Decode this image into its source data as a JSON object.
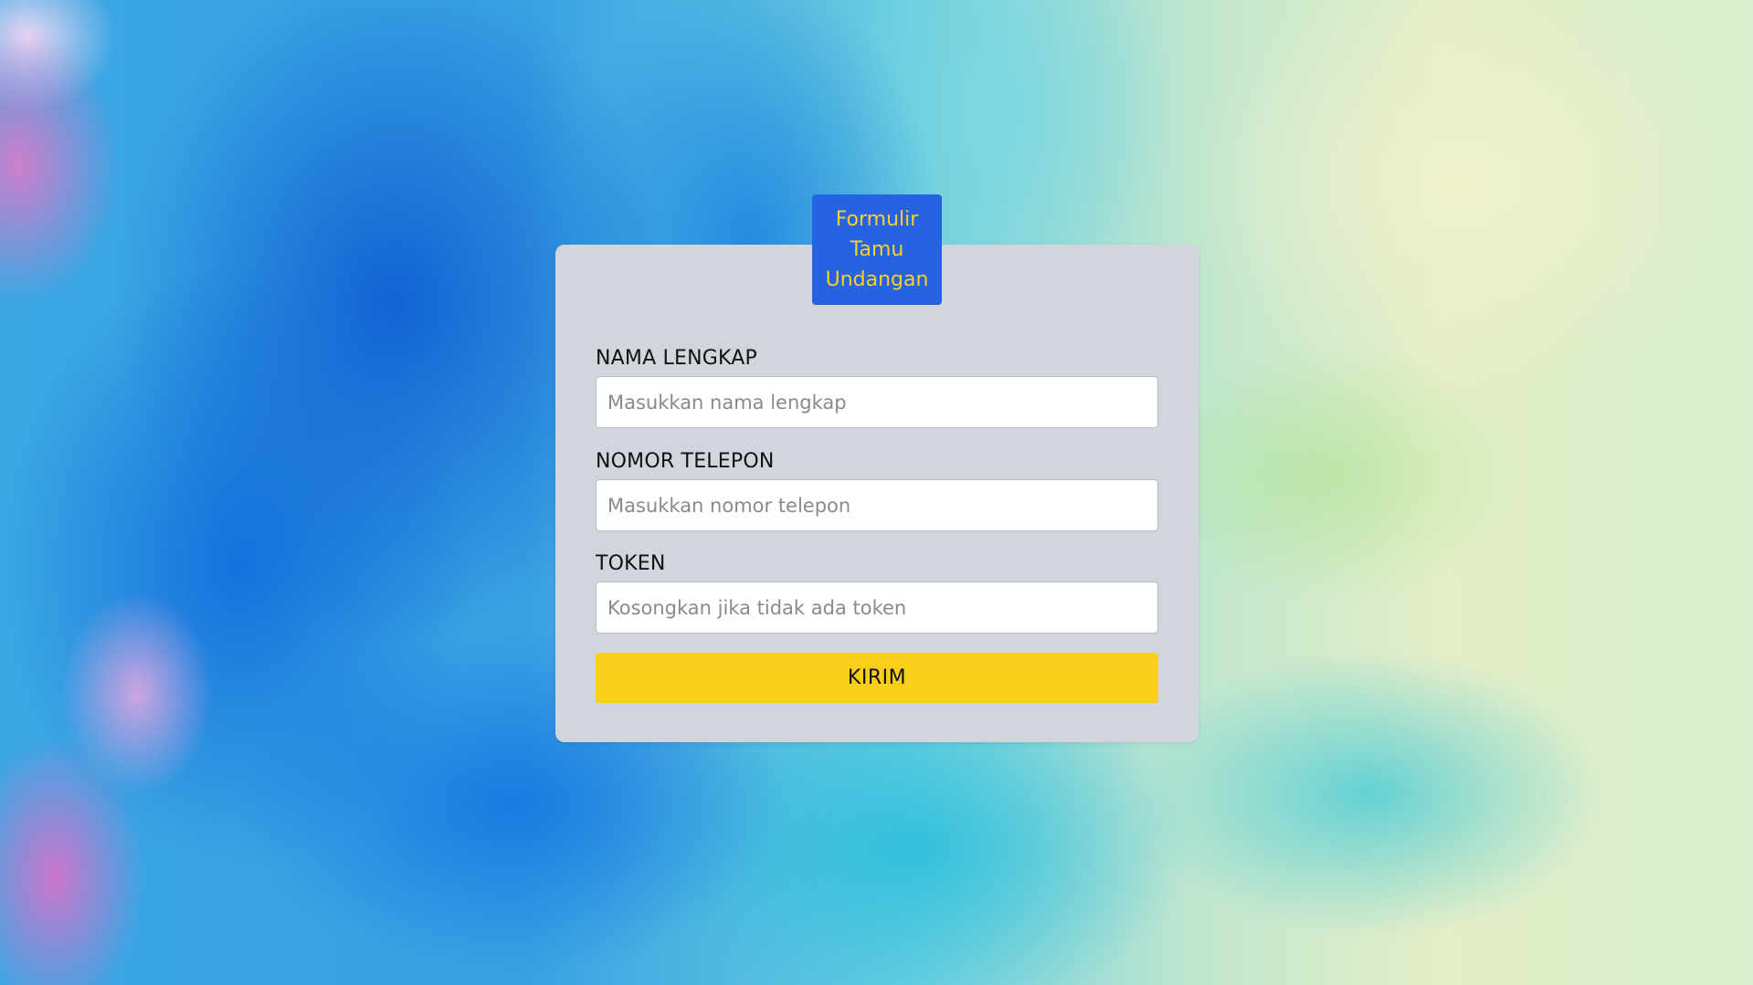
{
  "form": {
    "title": "Formulir Tamu Undangan",
    "fields": [
      {
        "label": "NAMA LENGKAP",
        "placeholder": "Masukkan nama lengkap",
        "value": ""
      },
      {
        "label": "NOMOR TELEPON",
        "placeholder": "Masukkan nomor telepon",
        "value": ""
      },
      {
        "label": "TOKEN",
        "placeholder": "Kosongkan jika tidak ada token",
        "value": ""
      }
    ],
    "submit_label": "KIRIM"
  },
  "colors": {
    "badge_bg": "#2563e0",
    "badge_text": "#f9cf2a",
    "card_bg": "#d2d5dc",
    "button_bg": "#f9cf19"
  }
}
